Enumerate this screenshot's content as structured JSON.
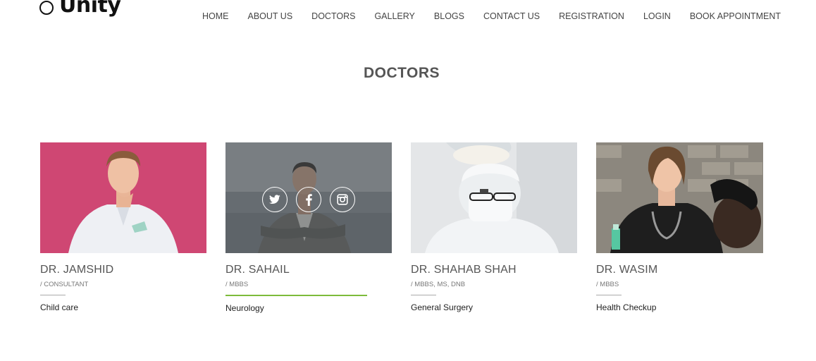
{
  "header": {
    "logo_text": "Unity",
    "nav": [
      "HOME",
      "ABOUT US",
      "DOCTORS",
      "GALLERY",
      "BLOGS",
      "CONTACT US",
      "REGISTRATION",
      "LOGIN",
      "BOOK APPOINTMENT"
    ]
  },
  "section": {
    "title": "DOCTORS"
  },
  "doctors": [
    {
      "name": "DR. JAMSHID",
      "role": "/ CONSULTANT",
      "specialty": "Child care",
      "photo_bg": "#d44d78"
    },
    {
      "name": "DR. SAHAIL",
      "role": "/ MBBS",
      "specialty": "Neurology",
      "photo_bg": "#8a9096",
      "hovered": true
    },
    {
      "name": "DR. SHAHAB SHAH",
      "role": "/ MBBS, MS, DNB",
      "specialty": "General Surgery",
      "photo_bg": "#e4e6e8"
    },
    {
      "name": "DR. WASIM",
      "role": "/ MBBS",
      "specialty": "Health Checkup",
      "photo_bg": "#7e7a73"
    }
  ],
  "social_icons": [
    "twitter-icon",
    "facebook-icon",
    "instagram-icon"
  ],
  "colors": {
    "accent": "#7dbb3b",
    "text": "#555555"
  }
}
